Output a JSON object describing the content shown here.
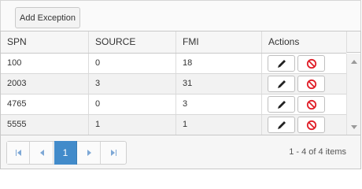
{
  "toolbar": {
    "add_label": "Add Exception"
  },
  "columns": [
    "SPN",
    "SOURCE",
    "FMI",
    "Actions"
  ],
  "rows": [
    {
      "spn": "100",
      "source": "0",
      "fmi": "18"
    },
    {
      "spn": "2003",
      "source": "3",
      "fmi": "31"
    },
    {
      "spn": "4765",
      "source": "0",
      "fmi": "3"
    },
    {
      "spn": "5555",
      "source": "1",
      "fmi": "1"
    }
  ],
  "pager": {
    "current_page": "1",
    "info": "1 - 4 of 4 items"
  },
  "colors": {
    "accent": "#428bca",
    "delete": "#e0202a",
    "edit": "#222222"
  },
  "icons": {
    "edit": "pencil-icon",
    "delete": "prohibited-icon"
  }
}
